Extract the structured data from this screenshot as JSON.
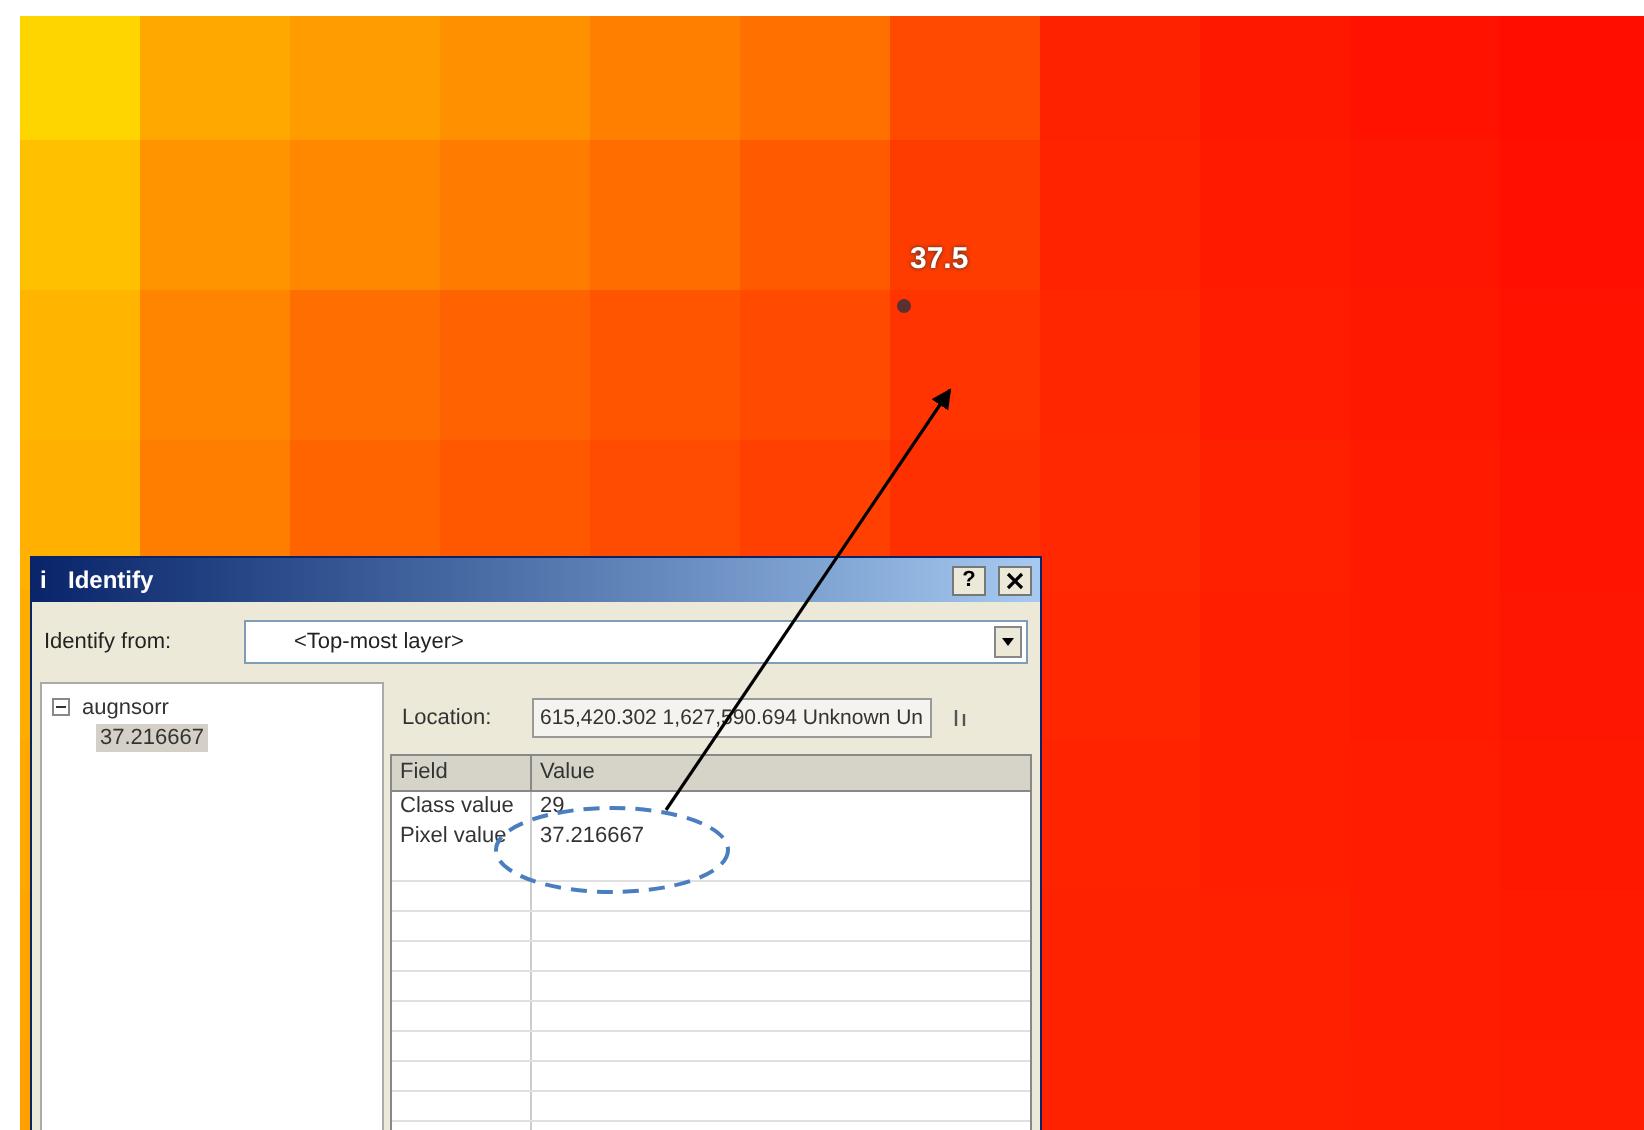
{
  "map": {
    "labels": [
      {
        "text": "37.5"
      }
    ]
  },
  "dialog": {
    "icon": "i",
    "title": "Identify",
    "help": "?",
    "identify_from": {
      "label": "Identify from:",
      "value": "<Top-most layer>"
    },
    "tree": [
      {
        "label": "augnsorr",
        "expanded": true,
        "children": [
          {
            "label": "37.216667",
            "selected": true
          }
        ]
      }
    ],
    "location": {
      "label": "Location:",
      "value": "615,420.302  1,627,590.694 Unknown Un"
    },
    "table": {
      "columns": [
        "Field",
        "Value"
      ],
      "rows": [
        [
          "Class value",
          "29"
        ],
        [
          "Pixel value",
          "37.216667"
        ]
      ]
    }
  }
}
